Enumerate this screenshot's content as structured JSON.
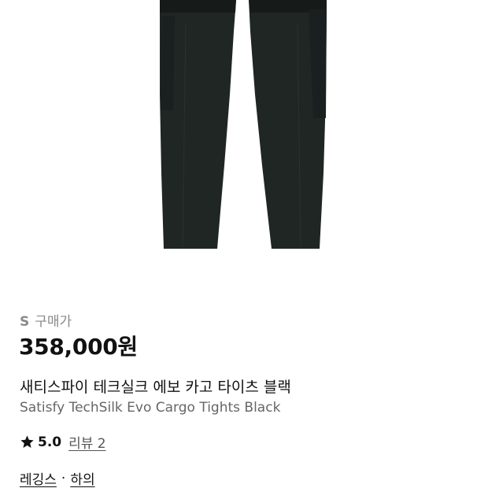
{
  "product": {
    "size_label": "S",
    "price_type_label": "구매가",
    "price": "358,000원",
    "name_ko": "새티스파이 테크실크 에보 카고 타이츠 블랙",
    "name_en": "Satisfy TechSilk Evo Cargo Tights Black",
    "image_icon": "product-image",
    "image_color": "#1f2624"
  },
  "rating": {
    "icon": "star-icon",
    "score": "5.0",
    "review_label": "리뷰 2"
  },
  "categories": {
    "items": [
      "레깅스",
      "하의"
    ],
    "separator": "·"
  }
}
